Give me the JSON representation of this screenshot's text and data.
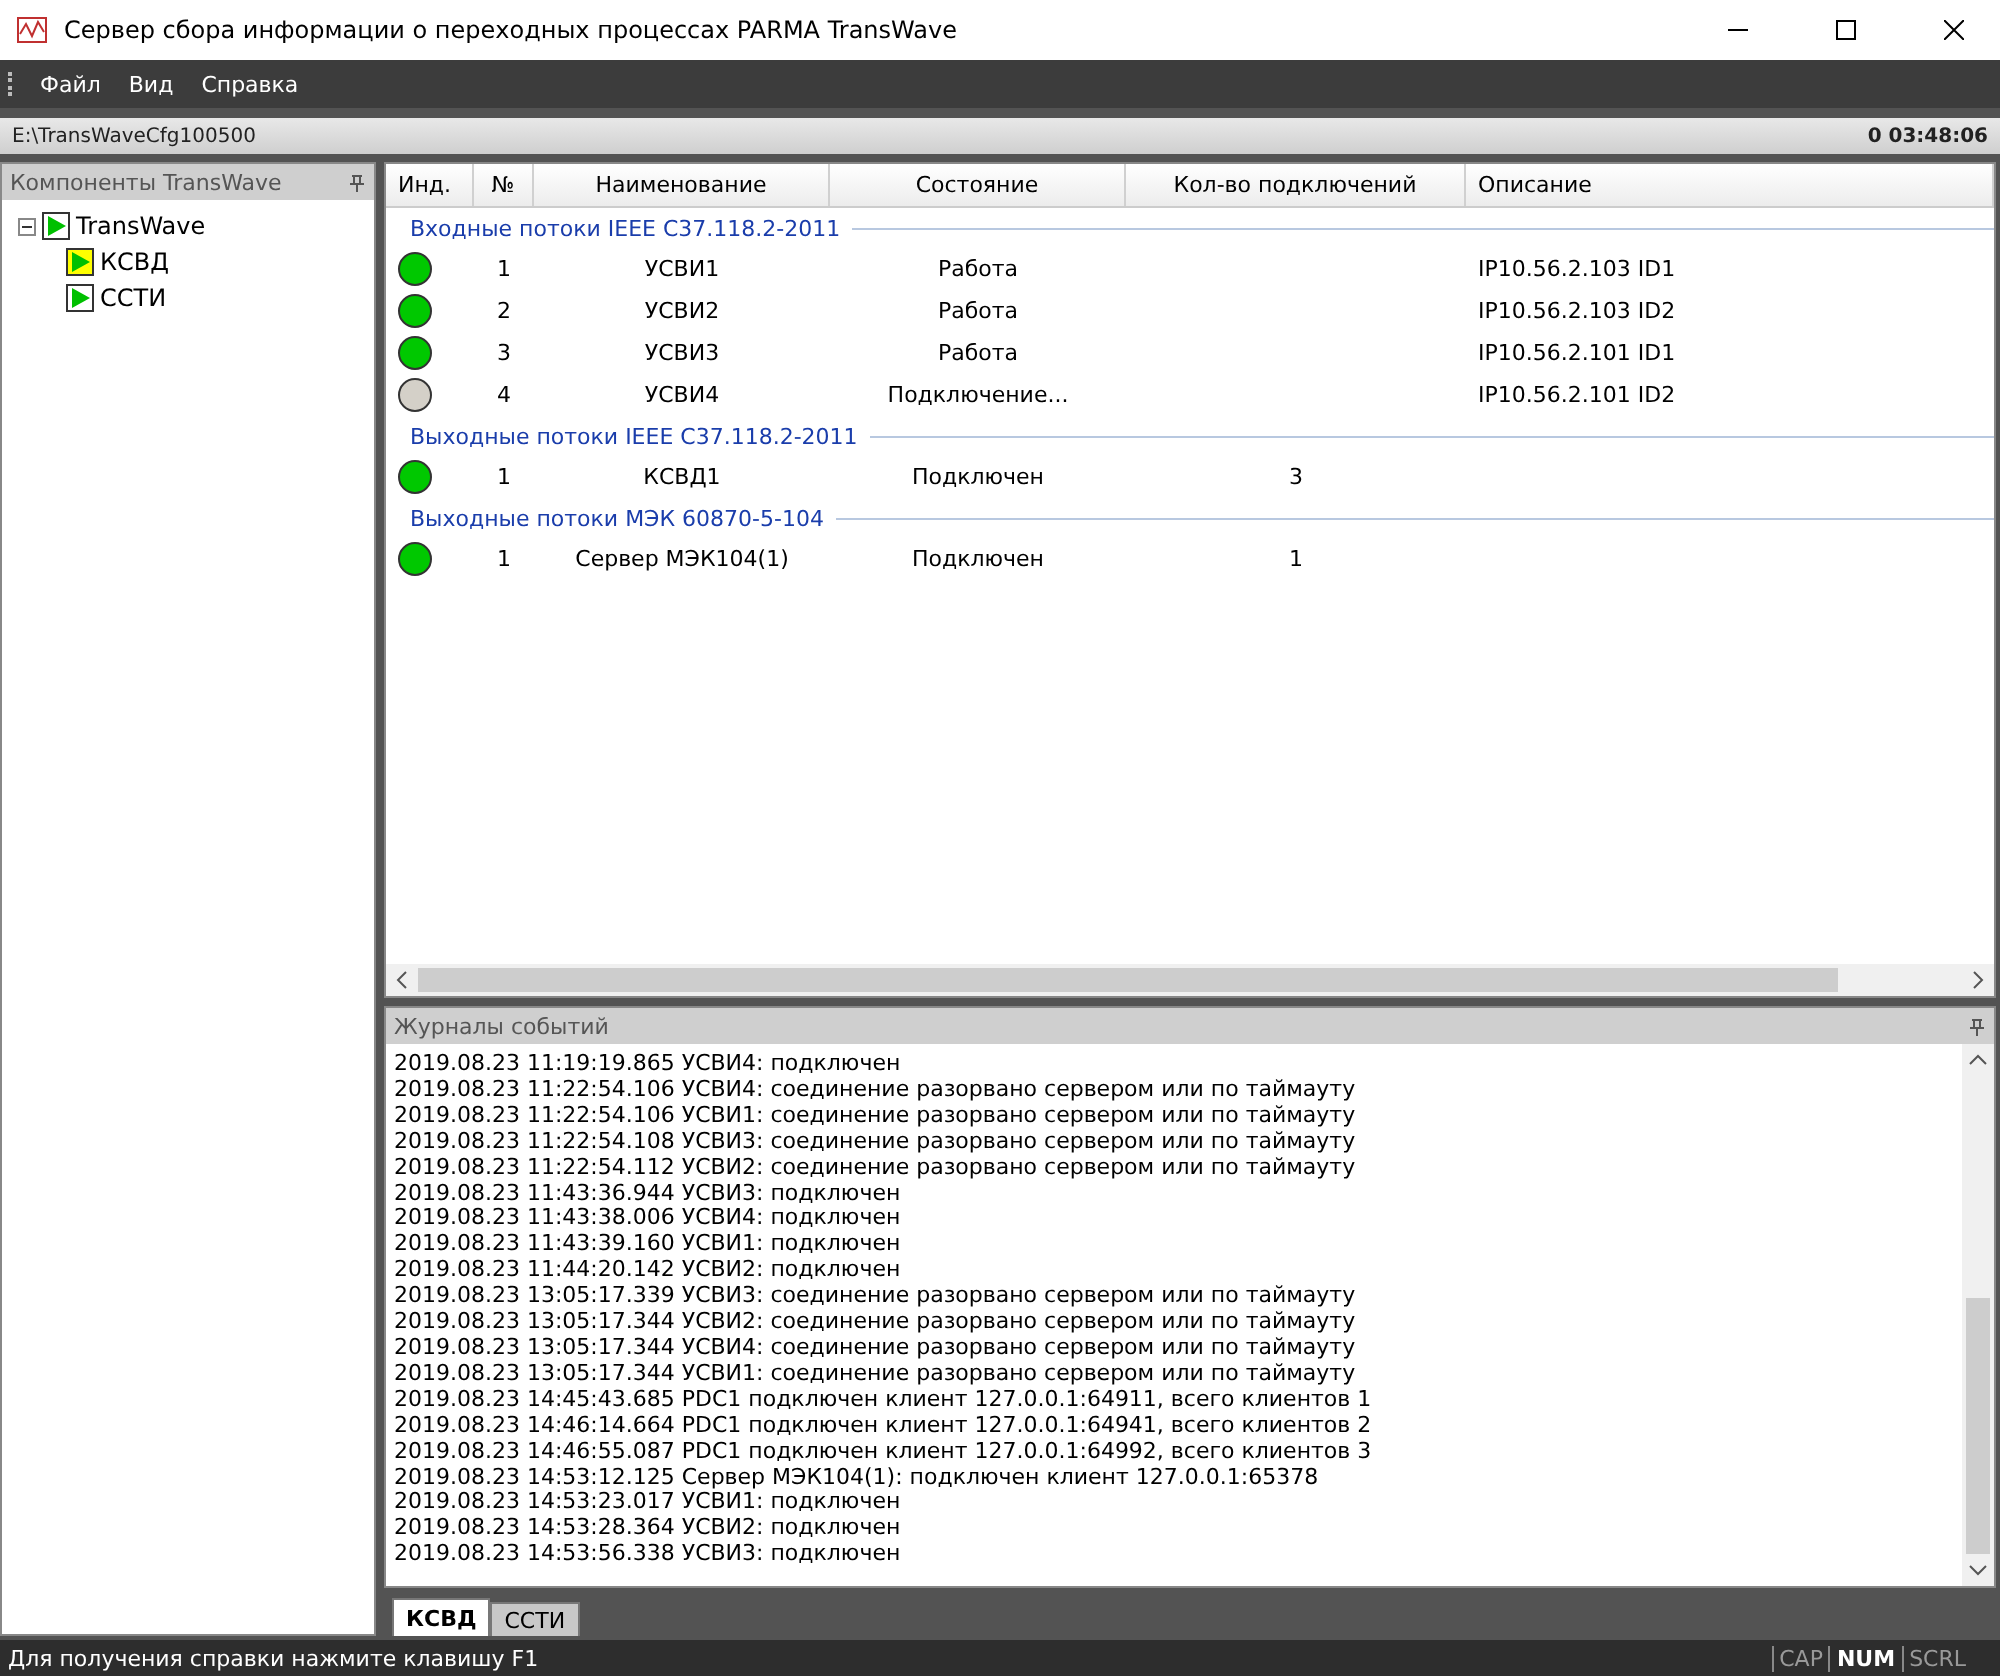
{
  "window": {
    "title": "Сервер сбора информации о переходных процессах PARMA TransWave"
  },
  "menu": [
    "Файл",
    "Вид",
    "Справка"
  ],
  "path_bar": {
    "path": "E:\\TransWaveCfg100500",
    "uptime": "0 03:48:06"
  },
  "sidebar": {
    "title": "Компоненты TransWave",
    "tree": [
      {
        "label": "TransWave",
        "expanded": true,
        "selected": false,
        "children": [
          {
            "label": "КСВД",
            "selected": true
          },
          {
            "label": "ССТИ",
            "selected": false
          }
        ]
      }
    ]
  },
  "table": {
    "columns": [
      "Инд.",
      "№",
      "Наименование",
      "Состояние",
      "Кол-во подключений",
      "Описание"
    ],
    "groups": [
      {
        "title": "Входные потоки IEEE C37.118.2-2011",
        "rows": [
          {
            "color": "#00c800",
            "num": "1",
            "name": "УСВИ1",
            "state": "Работа",
            "connections": "",
            "description": "IP10.56.2.103 ID1"
          },
          {
            "color": "#00c800",
            "num": "2",
            "name": "УСВИ2",
            "state": "Работа",
            "connections": "",
            "description": "IP10.56.2.103 ID2"
          },
          {
            "color": "#00c800",
            "num": "3",
            "name": "УСВИ3",
            "state": "Работа",
            "connections": "",
            "description": "IP10.56.2.101 ID1"
          },
          {
            "color": "#d4d0c8",
            "num": "4",
            "name": "УСВИ4",
            "state": "Подключение...",
            "connections": "",
            "description": "IP10.56.2.101 ID2"
          }
        ]
      },
      {
        "title": "Выходные потоки IEEE C37.118.2-2011",
        "rows": [
          {
            "color": "#00c800",
            "num": "1",
            "name": "КСВД1",
            "state": "Подключен",
            "connections": "3",
            "description": ""
          }
        ]
      },
      {
        "title": "Выходные потоки МЭК 60870-5-104",
        "rows": [
          {
            "color": "#00c800",
            "num": "1",
            "name": "Сервер МЭК104(1)",
            "state": "Подключен",
            "connections": "1",
            "description": ""
          }
        ]
      }
    ]
  },
  "log": {
    "title": "Журналы событий",
    "lines": [
      "2019.08.23 11:19:19.865 УСВИ4: подключен",
      "2019.08.23 11:22:54.106 УСВИ4: соединение разорвано сервером или по таймауту",
      "2019.08.23 11:22:54.106 УСВИ1: соединение разорвано сервером или по таймауту",
      "2019.08.23 11:22:54.108 УСВИ3: соединение разорвано сервером или по таймауту",
      "2019.08.23 11:22:54.112 УСВИ2: соединение разорвано сервером или по таймауту",
      "2019.08.23 11:43:36.944 УСВИ3: подключен",
      "2019.08.23 11:43:38.006 УСВИ4: подключен",
      "2019.08.23 11:43:39.160 УСВИ1: подключен",
      "2019.08.23 11:44:20.142 УСВИ2: подключен",
      "2019.08.23 13:05:17.339 УСВИ3: соединение разорвано сервером или по таймауту",
      "2019.08.23 13:05:17.344 УСВИ2: соединение разорвано сервером или по таймауту",
      "2019.08.23 13:05:17.344 УСВИ4: соединение разорвано сервером или по таймауту",
      "2019.08.23 13:05:17.344 УСВИ1: соединение разорвано сервером или по таймауту",
      "2019.08.23 14:45:43.685 PDC1 подключен клиент 127.0.0.1:64911, всего клиентов 1",
      "2019.08.23 14:46:14.664 PDC1 подключен клиент 127.0.0.1:64941, всего клиентов 2",
      "2019.08.23 14:46:55.087 PDC1 подключен клиент 127.0.0.1:64992, всего клиентов 3",
      "2019.08.23 14:53:12.125 Сервер МЭК104(1): подключен клиент 127.0.0.1:65378",
      "2019.08.23 14:53:23.017 УСВИ1: подключен",
      "2019.08.23 14:53:28.364 УСВИ2: подключен",
      "2019.08.23 14:53:56.338 УСВИ3: подключен"
    ],
    "tabs": [
      {
        "label": "КСВД",
        "selected": true
      },
      {
        "label": "ССТИ",
        "selected": false
      }
    ]
  },
  "status_bar": {
    "text": "Для получения справки нажмите клавишу F1",
    "indicators": [
      {
        "label": "CAP",
        "on": false
      },
      {
        "label": "NUM",
        "on": true
      },
      {
        "label": "SCRL",
        "on": false
      }
    ]
  }
}
